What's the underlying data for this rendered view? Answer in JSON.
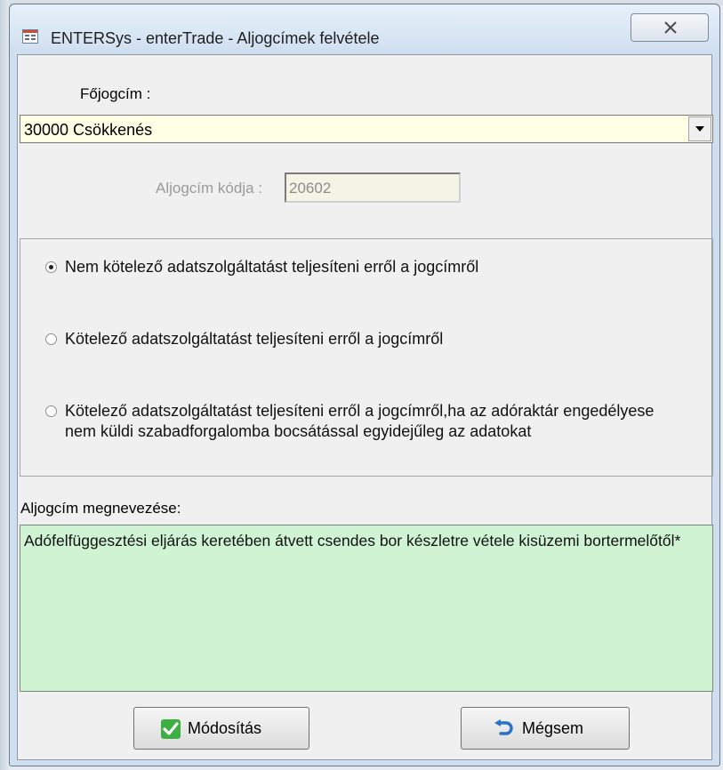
{
  "window": {
    "title": "ENTERSys - enterTrade - Aljogcímek felvétele",
    "close_icon": "close-icon"
  },
  "fojogcim": {
    "label": "Főjogcím :",
    "selected": "30000 Csökkenés"
  },
  "aljogcim_kod": {
    "label": "Aljogcím kódja :",
    "value": "20602"
  },
  "options": [
    {
      "label": "Nem kötelező adatszolgáltatást teljesíteni erről a jogcímről",
      "checked": true
    },
    {
      "label": "Kötelező adatszolgáltatást teljesíteni erről a jogcímről",
      "checked": false
    },
    {
      "label": "Kötelező adatszolgáltatást teljesíteni erről a jogcímről,ha az adóraktár engedélyese nem küldi szabadforgalomba bocsátással egyidejűleg az adatokat",
      "checked": false
    }
  ],
  "megnevezes": {
    "label": "Aljogcím megnevezése:",
    "value": "Adófelfüggesztési eljárás keretében átvett csendes bor készletre vétele kisüzemi bortermelőtől*"
  },
  "buttons": {
    "modositas": "Módosítás",
    "megsem": "Mégsem"
  },
  "colors": {
    "combo_bg": "#ffffe6",
    "textarea_bg": "#cff3d3",
    "check_green": "#3cb043",
    "undo_blue": "#2a72c8"
  }
}
